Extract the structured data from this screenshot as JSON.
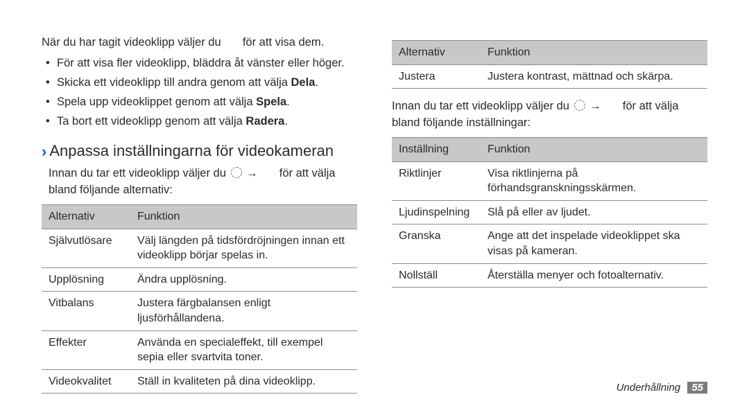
{
  "left": {
    "intro_a": "När du har tagit videoklipp väljer du",
    "intro_b": "för att visa dem.",
    "bullets": [
      "För att visa fler videoklipp, bläddra åt vänster eller höger.",
      "Skicka ett videoklipp till andra genom att välja ",
      "Spela upp videoklippet genom att välja ",
      "Ta bort ett videoklipp genom att välja "
    ],
    "bold1": "Dela",
    "bold2": "Spela",
    "bold3": "Radera",
    "heading": "Anpassa inställningarna för videokameran",
    "sub_a": "Innan du tar ett videoklipp väljer du",
    "sub_b": "för att välja bland följande alternativ:",
    "th1": "Alternativ",
    "th2": "Funktion",
    "rows": [
      {
        "a": "Självutlösare",
        "b": "Välj längden på tidsfördröjningen innan ett videoklipp börjar spelas in."
      },
      {
        "a": "Upplösning",
        "b": "Ändra upplösning."
      },
      {
        "a": "Vitbalans",
        "b": "Justera färgbalansen enligt ljusförhållandena."
      },
      {
        "a": "Effekter",
        "b": "Använda en specialeffekt, till exempel sepia eller svartvita toner."
      },
      {
        "a": "Videokvalitet",
        "b": "Ställ in kvaliteten på dina videoklipp."
      }
    ]
  },
  "right": {
    "t1_th1": "Alternativ",
    "t1_th2": "Funktion",
    "t1_rows": [
      {
        "a": "Justera",
        "b": "Justera kontrast, mättnad och skärpa."
      }
    ],
    "mid_a": "Innan du tar ett videoklipp väljer du",
    "mid_b": "för att välja bland följande inställningar:",
    "t2_th1": "Inställning",
    "t2_th2": "Funktion",
    "t2_rows": [
      {
        "a": "Riktlinjer",
        "b": "Visa riktlinjerna på förhandsgranskningsskärmen."
      },
      {
        "a": "Ljudinspelning",
        "b": "Slå på eller av ljudet."
      },
      {
        "a": "Granska",
        "b": "Ange att det inspelade videoklippet ska visas på kameran."
      },
      {
        "a": "Nollställ",
        "b": "Återställa menyer och fotoalternativ."
      }
    ]
  },
  "footer": {
    "section": "Underhållning",
    "page": "55"
  }
}
